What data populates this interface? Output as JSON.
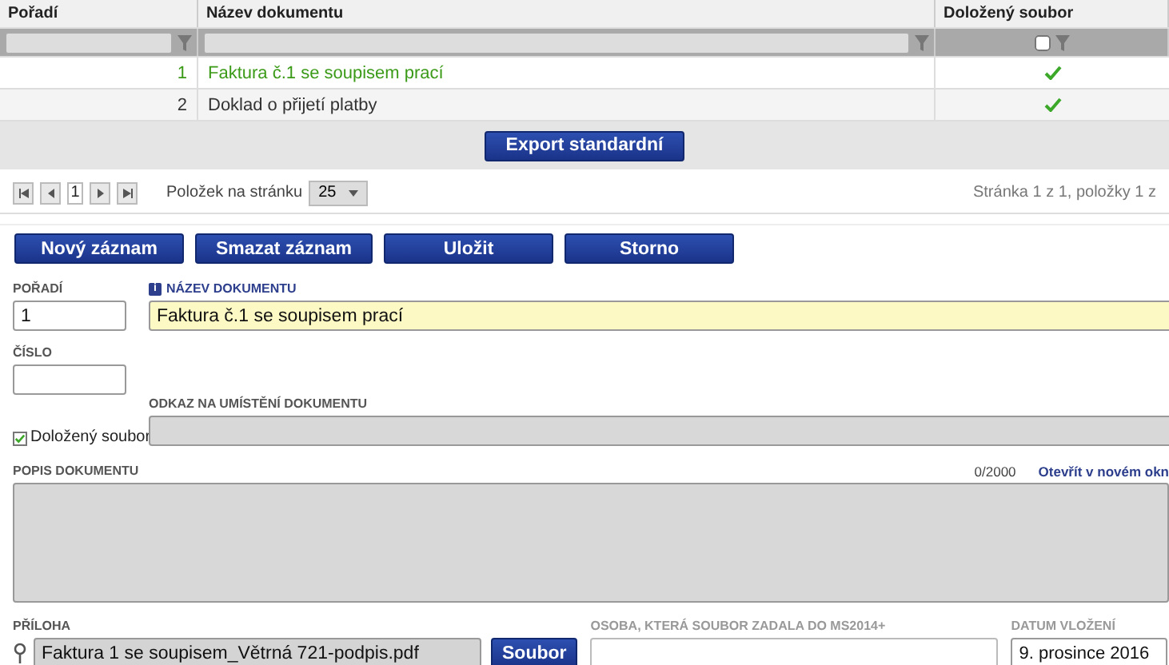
{
  "table": {
    "columns": [
      "Pořadí",
      "Název dokumentu",
      "Doložený soubor"
    ],
    "filter": {
      "checked": false
    },
    "rows": [
      {
        "order": "1",
        "name": "Faktura č.1 se soupisem prací",
        "has_file": true,
        "selected": true
      },
      {
        "order": "2",
        "name": "Doklad o přijetí platby",
        "has_file": true,
        "selected": false
      }
    ]
  },
  "export_button": "Export standardní",
  "pager": {
    "page": "1",
    "per_page_label": "Položek na stránku",
    "per_page": "25",
    "summary": "Stránka 1 z 1, položky 1 z"
  },
  "actions": [
    "Nový záznam",
    "Smazat záznam",
    "Uložit",
    "Storno"
  ],
  "form": {
    "order_label": "POŘADÍ",
    "order_value": "1",
    "name_label": "NÁZEV DOKUMENTU",
    "name_badge": "i",
    "name_value": "Faktura č.1 se soupisem prací",
    "number_label": "ČÍSLO",
    "file_attached": {
      "label": "Doložený soubor",
      "checked": true
    },
    "link_label": "ODKAZ NA UMÍSTĚNÍ DOKUMENTU",
    "description_label": "POPIS DOKUMENTU",
    "description_count": "0/2000",
    "open_new_window": "Otevřít v novém okn",
    "attachment_label": "PŘÍLOHA",
    "attachment_value": "Faktura 1 se soupisem_Větrná 721-podpis.pdf",
    "file_button": "Soubor",
    "person_label": "OSOBA, KTERÁ SOUBOR ZADALA DO MS2014+",
    "date_label": "DATUM VLOŽENÍ",
    "date_value": "9. prosince 2016"
  }
}
